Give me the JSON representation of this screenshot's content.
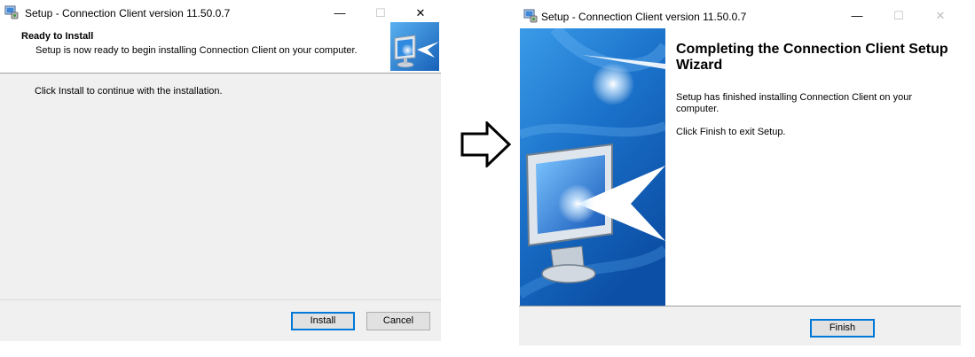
{
  "left_window": {
    "title": "Setup - Connection Client version 11.50.0.7",
    "header_title": "Ready to Install",
    "header_subtitle": "Setup is now ready to begin installing Connection Client on your computer.",
    "body_text": "Click Install to continue with the installation.",
    "install_label": "Install",
    "cancel_label": "Cancel",
    "minimize_glyph": "—",
    "maximize_glyph": "☐",
    "close_glyph": "✕"
  },
  "right_window": {
    "title": "Setup - Connection Client version 11.50.0.7",
    "heading": "Completing the Connection Client Setup Wizard",
    "body_line1": "Setup has finished installing Connection Client on your computer.",
    "body_line2": "Click Finish to exit Setup.",
    "finish_label": "Finish",
    "minimize_glyph": "—",
    "maximize_glyph": "☐",
    "close_glyph": "✕"
  },
  "colors": {
    "window_bg": "#ffffff",
    "dialog_bg": "#f0f0f0",
    "accent": "#0078d7",
    "banner_blue": "#1a6fc8"
  },
  "icons": [
    "setup-app-icon",
    "monitor-arrow-icon",
    "right-arrow-icon",
    "wizard-banner-image"
  ]
}
